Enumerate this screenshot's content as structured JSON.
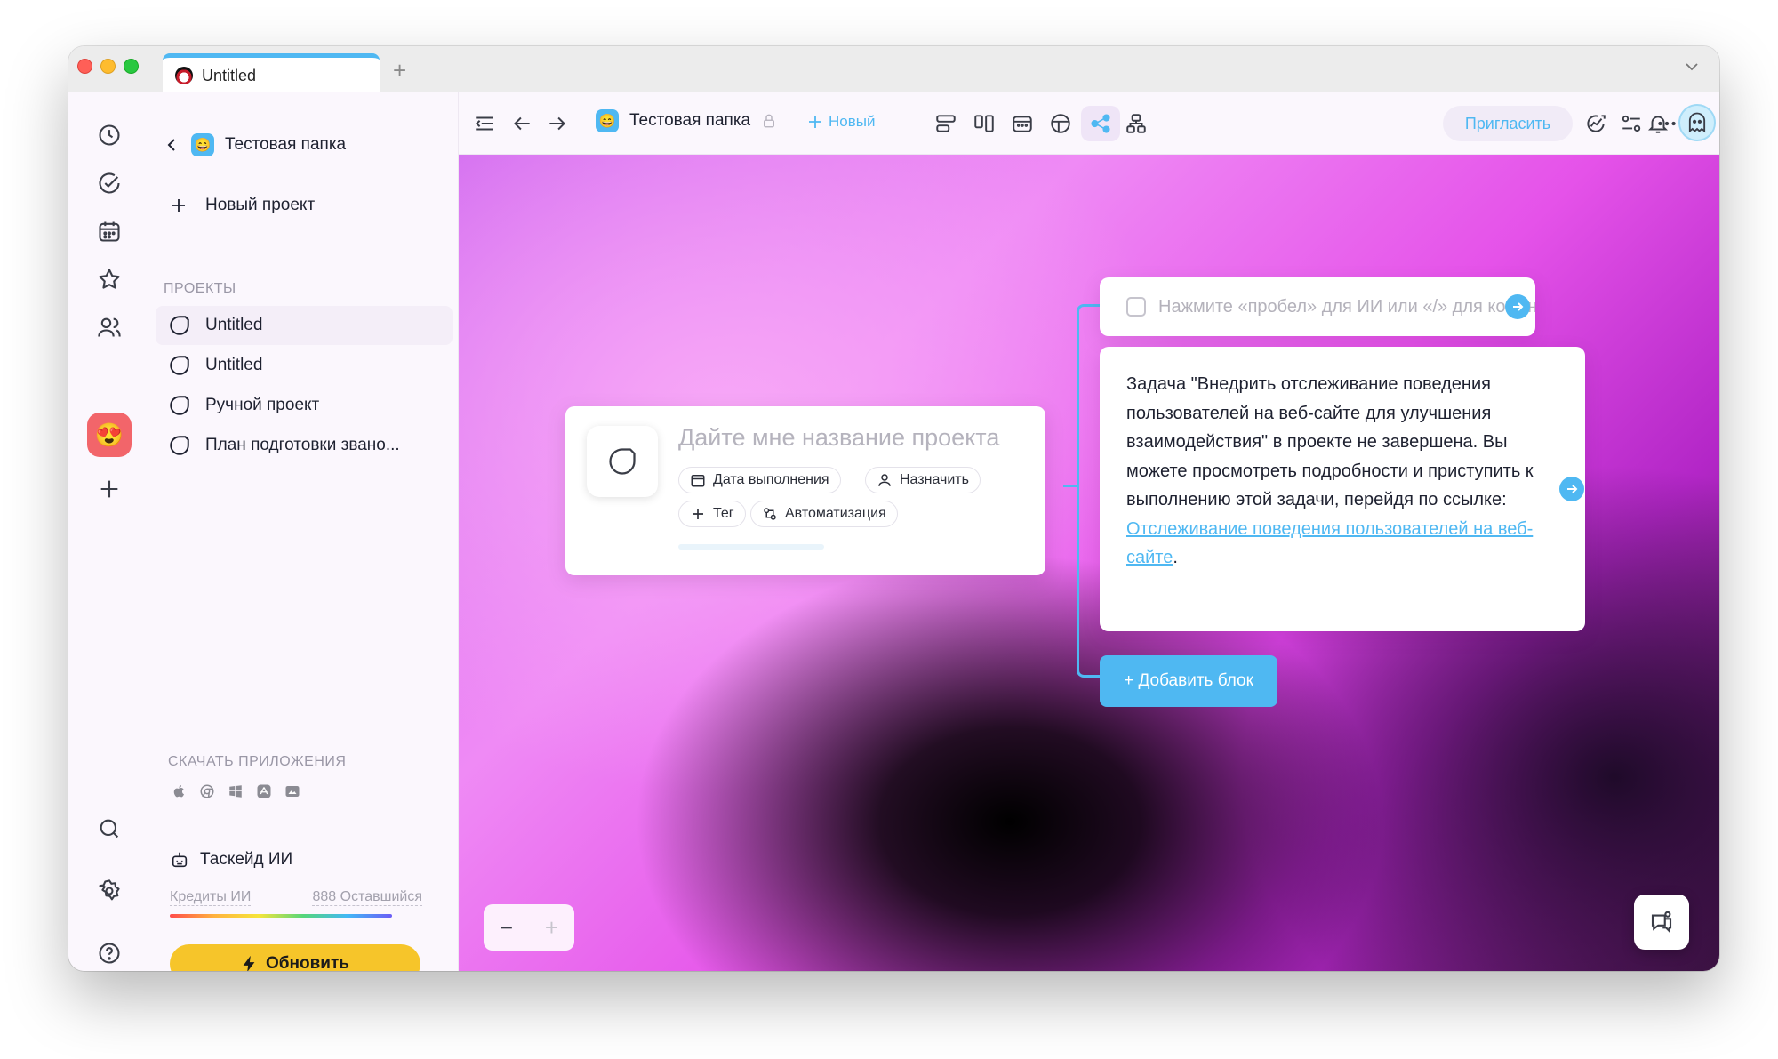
{
  "window": {
    "tab_title": "Untitled",
    "tab_add": "+",
    "tab_dropdown": "⌄"
  },
  "sidebar": {
    "folder_name": "Тестовая папка",
    "folder_emoji": "😄",
    "new_project_label": "Новый проект",
    "projects_section": "ПРОЕКТЫ",
    "projects": [
      {
        "label": "Untitled"
      },
      {
        "label": "Untitled"
      },
      {
        "label": "Ручной проект"
      },
      {
        "label": "План подготовки звано..."
      }
    ],
    "apps_section": "СКАЧАТЬ ПРИЛОЖЕНИЯ",
    "ai_title": "Таскейд ИИ",
    "ai_credits_label": "Кредиты ИИ",
    "ai_credits_remaining": "888 Оставшийся",
    "upgrade_label": "Обновить"
  },
  "rail": {
    "avatar_emoji": "😍"
  },
  "toolbar": {
    "breadcrumb": "Тестовая папка",
    "breadcrumb_emoji": "😄",
    "new_label": "Новый",
    "invite_label": "Пригласить"
  },
  "canvas": {
    "project_name_placeholder": "Дайте мне название проекта",
    "chips": {
      "due_date": "Дата выполнения",
      "assign": "Назначить",
      "tag": "Тег",
      "automation": "Автоматизация"
    },
    "input_placeholder": "Нажмите «пробел» для ИИ или «/» для команд",
    "task_text": "Задача \"Внедрить отслеживание поведения пользователей на веб-сайте для улучшения взаимодействия\" в проекте не завершена. Вы можете просмотреть подробности и приступить к выполнению этой задачи, перейдя по ссылке: ",
    "task_link": "Отслеживание поведения пользователей на веб-сайте",
    "task_end": ".",
    "add_block_label": "+ Добавить блок",
    "zoom_out": "−",
    "zoom_in": "+"
  },
  "colors": {
    "accent": "#4fb8f2",
    "upgrade": "#f6c52a",
    "avatar_bg": "#f2656a"
  }
}
